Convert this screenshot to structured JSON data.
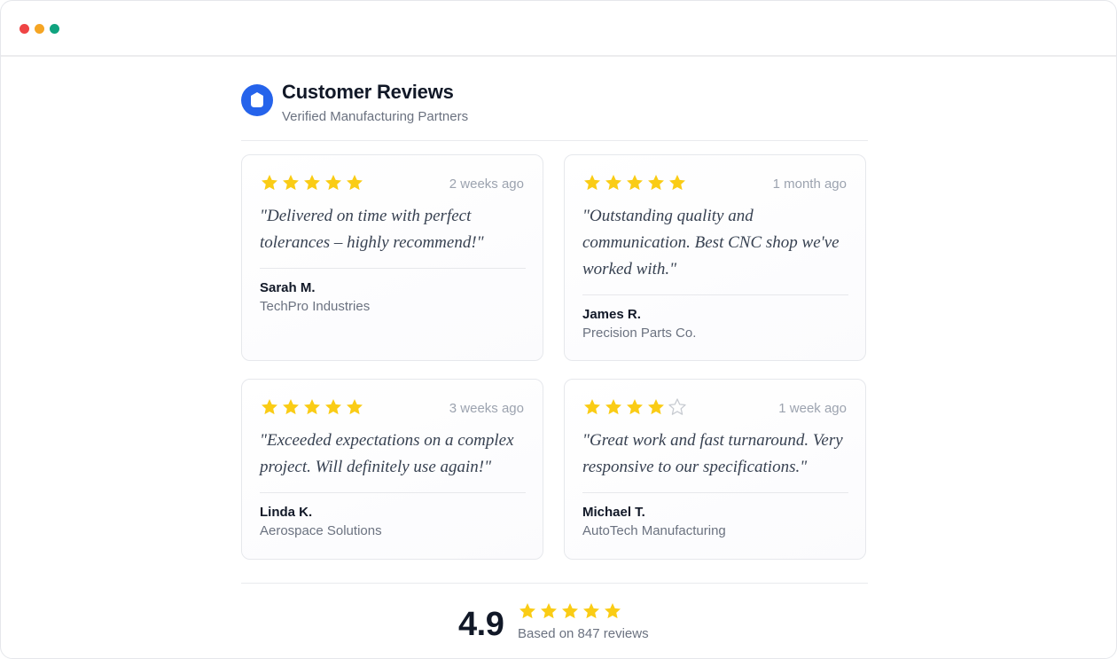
{
  "header": {
    "title": "Customer Reviews",
    "subtitle": "Verified Manufacturing Partners",
    "logo_icon": "shield-icon",
    "accent_color": "#2563eb"
  },
  "star_color": "#facc15",
  "reviews": [
    {
      "rating": 5,
      "date": "2 weeks ago",
      "quote": "\"Delivered on time with perfect tolerances – highly recommend!\"",
      "name": "Sarah M.",
      "company": "TechPro Industries"
    },
    {
      "rating": 5,
      "date": "1 month ago",
      "quote": "\"Outstanding quality and communication. Best CNC shop we've worked with.\"",
      "name": "James R.",
      "company": "Precision Parts Co."
    },
    {
      "rating": 5,
      "date": "3 weeks ago",
      "quote": "\"Exceeded expectations on a complex project. Will definitely use again!\"",
      "name": "Linda K.",
      "company": "Aerospace Solutions"
    },
    {
      "rating": 4,
      "date": "1 week ago",
      "quote": "\"Great work and fast turnaround. Very responsive to our specifications.\"",
      "name": "Michael T.",
      "company": "AutoTech Manufacturing"
    }
  ],
  "summary": {
    "score": "4.9",
    "rating": 5,
    "count_text": "Based on 847 reviews"
  }
}
